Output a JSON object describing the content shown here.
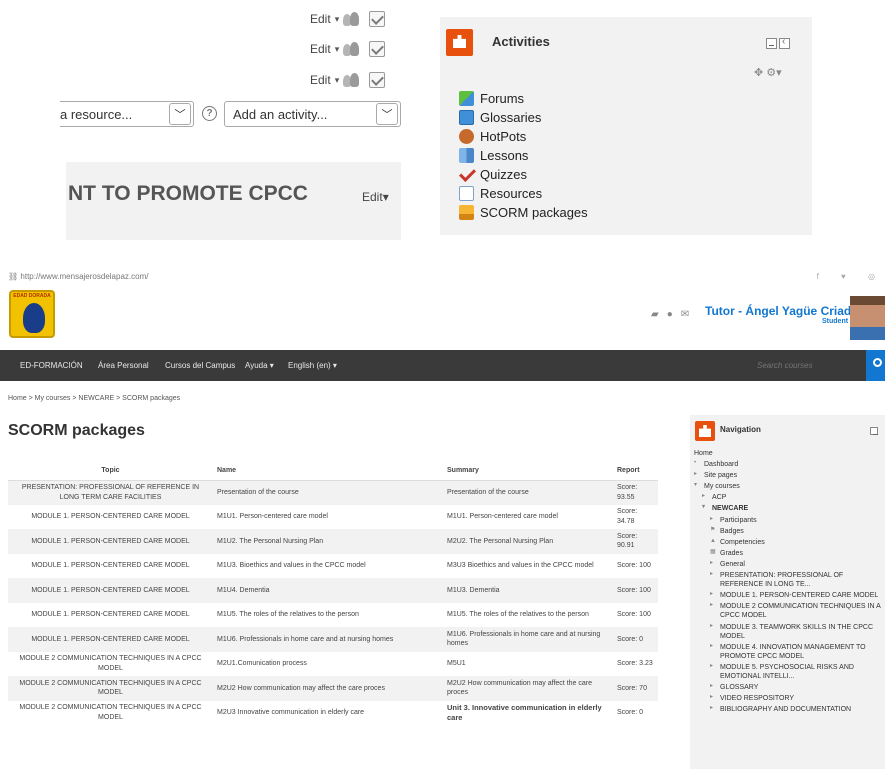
{
  "course_edit": {
    "edit_label": "Edit",
    "resource_select": "a resource...",
    "activity_select": "Add an activity...",
    "section_title": "NT TO PROMOTE CPCC",
    "section_edit": "Edit"
  },
  "activities_block": {
    "title": "Activities",
    "items": [
      "Forums",
      "Glossaries",
      "HotPots",
      "Lessons",
      "Quizzes",
      "Resources",
      "SCORM packages"
    ]
  },
  "browser": {
    "url": "http://www.mensajerosdelapaz.com/"
  },
  "header": {
    "logo_text": "EDAD DORADA",
    "user_name": "Tutor - Ángel Yagüe Criado",
    "user_role": "Student"
  },
  "navbar": {
    "items": [
      "ED-FORMACIÓN",
      "Área Personal",
      "Cursos del Campus",
      "Ayuda ▾",
      "English (en) ▾"
    ],
    "search_placeholder": "Search courses"
  },
  "breadcrumb": "Home > My courses > NEWCARE > SCORM packages",
  "page_title": "SCORM packages",
  "table": {
    "headers": [
      "Topic",
      "Name",
      "Summary",
      "Report"
    ],
    "rows": [
      [
        "PRESENTATION: PROFESSIONAL OF REFERENCE IN LONG TERM CARE FACILITIES",
        "Presentation of the course",
        "Presentation of the course",
        "Score: 93.55"
      ],
      [
        "MODULE 1. PERSON-CENTERED CARE MODEL",
        "M1U1. Person-centered care model",
        "M1U1. Person-centered care model",
        "Score: 34.78"
      ],
      [
        "MODULE 1. PERSON-CENTERED CARE MODEL",
        "M1U2. The Personal Nursing Plan",
        "M2U2. The Personal Nursing Plan",
        "Score: 90.91"
      ],
      [
        "MODULE 1. PERSON-CENTERED CARE MODEL",
        "M1U3. Bioethics and values in the CPCC model",
        "M3U3 Bioethics and values in the CPCC model",
        "Score: 100"
      ],
      [
        "MODULE 1. PERSON-CENTERED CARE MODEL",
        "M1U4. Dementia",
        "M1U3. Dementia",
        "Score: 100"
      ],
      [
        "MODULE 1. PERSON-CENTERED CARE MODEL",
        "M1U5. The roles of the relatives to the person",
        "M1U5. The roles of the relatives to the person",
        "Score: 100"
      ],
      [
        "MODULE 1. PERSON-CENTERED CARE MODEL",
        "M1U6. Professionals in home care and at nursing homes",
        "M1U6. Professionals in home care and at nursing homes",
        "Score: 0"
      ],
      [
        "MODULE 2 COMMUNICATION TECHNIQUES IN A CPCC MODEL",
        "M2U1.Comunication process",
        "M5U1",
        "Score: 3.23"
      ],
      [
        "MODULE 2 COMMUNICATION TECHNIQUES IN A CPCC MODEL",
        "M2U2 How communication may affect the care proces",
        "M2U2 How communication may affect the care proces",
        "Score: 70"
      ],
      [
        "MODULE 2 COMMUNICATION TECHNIQUES IN A CPCC MODEL",
        "M2U3 Innovative communication in elderly care",
        "Unit 3. Innovative communication in elderly care",
        "Score: 0"
      ]
    ]
  },
  "navigation_block": {
    "title": "Navigation",
    "items": [
      {
        "label": "Home",
        "marker": ""
      },
      {
        "label": "Dashboard",
        "marker": "•"
      },
      {
        "label": "Site pages",
        "marker": "▸"
      },
      {
        "label": "My courses",
        "marker": "▾"
      },
      {
        "label": "ACP",
        "marker": "▸"
      },
      {
        "label": "NEWCARE",
        "marker": "▾"
      },
      {
        "label": "Participants",
        "marker": "▸"
      },
      {
        "label": "Badges",
        "marker": "⚑"
      },
      {
        "label": "Competencies",
        "marker": "▲"
      },
      {
        "label": "Grades",
        "marker": "▦"
      },
      {
        "label": "General",
        "marker": "▸"
      },
      {
        "label": "PRESENTATION: PROFESSIONAL OF REFERENCE IN LONG TE...",
        "marker": "▸"
      },
      {
        "label": "MODULE 1. PERSON-CENTERED CARE MODEL",
        "marker": "▸"
      },
      {
        "label": "MODULE 2 COMMUNICATION TECHNIQUES IN A CPCC MODEL",
        "marker": "▸"
      },
      {
        "label": "MODULE 3. TEAMWORK SKILLS IN THE CPCC MODEL",
        "marker": "▸"
      },
      {
        "label": "MODULE 4. INNOVATION MANAGEMENT TO PROMOTE CPCC MODEL",
        "marker": "▸"
      },
      {
        "label": "MODULE 5. PSYCHOSOCIAL RISKS AND EMOTIONAL INTELLI...",
        "marker": "▸"
      },
      {
        "label": "GLOSSARY",
        "marker": "▸"
      },
      {
        "label": "VIDEO RESPOSITORY",
        "marker": "▸"
      },
      {
        "label": "BIBLIOGRAPHY AND DOCUMENTATION",
        "marker": "▸"
      }
    ]
  }
}
